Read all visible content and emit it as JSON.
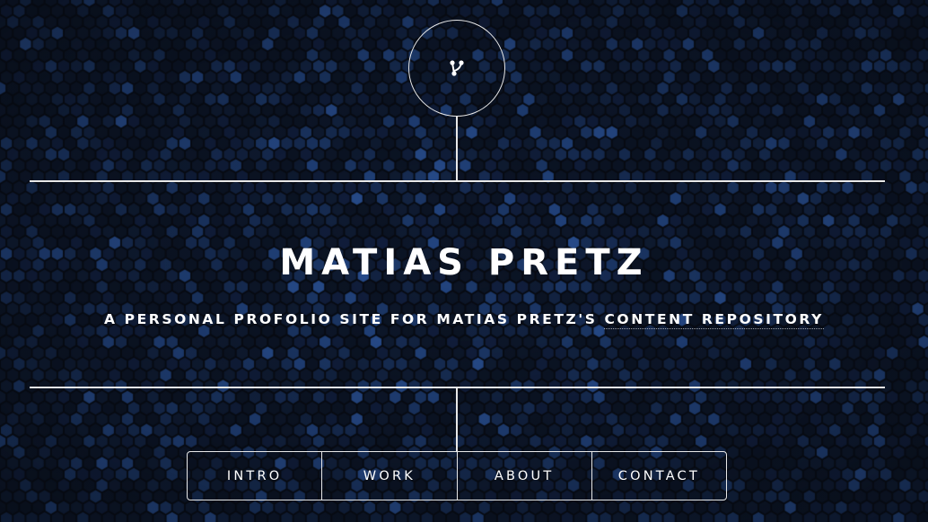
{
  "site": {
    "title": "MATIAS PRETZ",
    "subtitle_prefix": "A PERSONAL PROFOLIO SITE FOR MATIAS PRETZ'S ",
    "subtitle_link": "CONTENT REPOSITORY"
  },
  "logo": {
    "icon": "git-fork-icon"
  },
  "nav": {
    "items": [
      {
        "label": "INTRO"
      },
      {
        "label": "WORK"
      },
      {
        "label": "ABOUT"
      },
      {
        "label": "CONTACT"
      }
    ]
  },
  "colors": {
    "background": "#0a0d14",
    "hex_pattern": "#1c3a6e",
    "lines": "#e8e8e8",
    "text": "#ffffff"
  }
}
